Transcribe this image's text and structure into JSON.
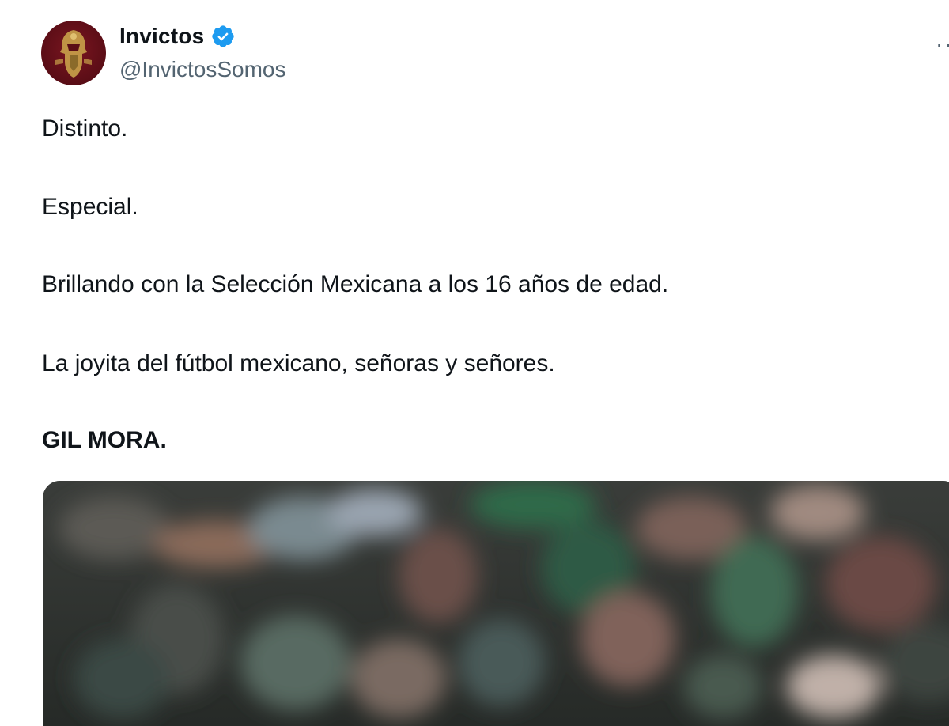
{
  "tweet": {
    "display_name": "Invictos",
    "handle": "@InvictosSomos",
    "verified_icon": "verified-badge-icon",
    "more_icon": "more-options-icon",
    "lines": [
      "Distinto.",
      "Especial.",
      "Brillando con la Selección Mexicana a los 16 años de edad.",
      "La joyita del fútbol mexicano, señoras y señores.",
      "GIL MORA."
    ],
    "media": {
      "description_icon": "blurred-crowd-photo"
    }
  },
  "colors": {
    "verified": "#1d9bf0",
    "avatar_bg": "#5a0d16",
    "handle": "#536471",
    "text": "#0f1419"
  }
}
